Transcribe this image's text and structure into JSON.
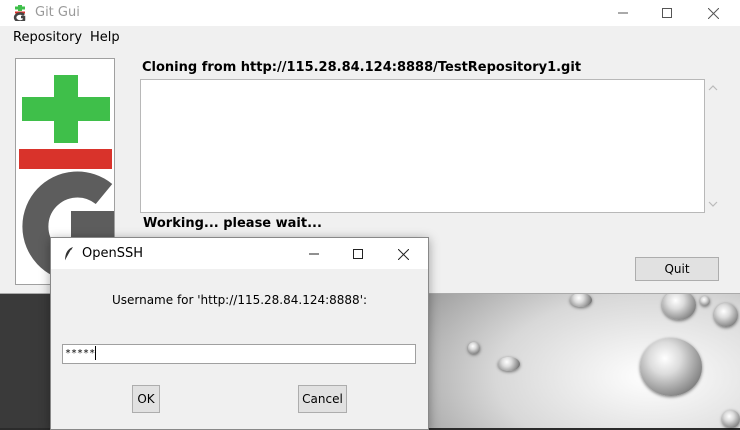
{
  "main_window": {
    "title": "Git Gui",
    "menu": [
      "Repository",
      "Help"
    ],
    "clone_status": "Cloning from http://115.28.84.124:8888/TestRepository1.git",
    "working_status": "Working... please wait...",
    "quit_label": "Quit",
    "window_controls": [
      "minimize-icon",
      "maximize-icon",
      "close-icon"
    ]
  },
  "ssh_dialog": {
    "title": "OpenSSH",
    "prompt": "Username for 'http://115.28.84.124:8888':",
    "input_value": "*****",
    "ok_label": "OK",
    "cancel_label": "Cancel"
  },
  "colors": {
    "logo_green": "#3fbf4a",
    "logo_red": "#d9332b",
    "logo_gray": "#5d5d5d"
  }
}
